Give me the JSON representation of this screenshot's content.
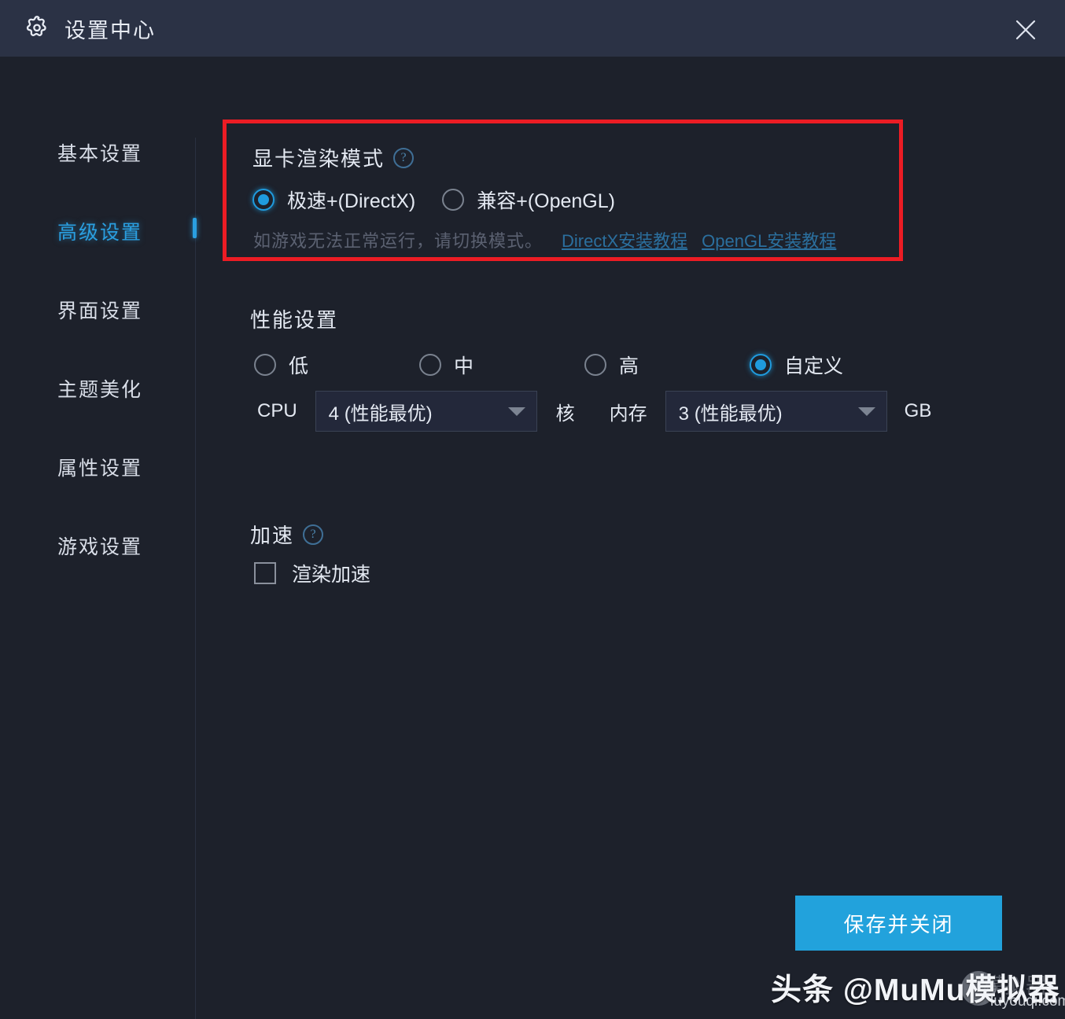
{
  "window": {
    "title": "设置中心",
    "gear_icon": "gear-icon",
    "close_icon": "close-icon"
  },
  "sidebar": {
    "items": [
      {
        "label": "基本设置",
        "active": false
      },
      {
        "label": "高级设置",
        "active": true
      },
      {
        "label": "界面设置",
        "active": false
      },
      {
        "label": "主题美化",
        "active": false
      },
      {
        "label": "属性设置",
        "active": false
      },
      {
        "label": "游戏设置",
        "active": false
      }
    ]
  },
  "render_mode": {
    "title": "显卡渲染模式",
    "help_icon": "?",
    "options": [
      {
        "label": "极速+(DirectX)",
        "selected": true
      },
      {
        "label": "兼容+(OpenGL)",
        "selected": false
      }
    ],
    "hint": "如游戏无法正常运行，请切换模式。",
    "links": [
      "DirectX安装教程",
      "OpenGL安装教程"
    ]
  },
  "performance": {
    "title": "性能设置",
    "options": [
      {
        "label": "低",
        "selected": false
      },
      {
        "label": "中",
        "selected": false
      },
      {
        "label": "高",
        "selected": false
      },
      {
        "label": "自定义",
        "selected": true
      }
    ],
    "cpu": {
      "label": "CPU",
      "value": "4 (性能最优)",
      "unit": "核"
    },
    "memory": {
      "label": "内存",
      "value": "3 (性能最优)",
      "unit": "GB"
    }
  },
  "acceleration": {
    "title": "加速",
    "help_icon": "?",
    "checkbox": {
      "label": "渲染加速",
      "checked": false
    }
  },
  "footer": {
    "save_label": "保存并关闭"
  },
  "watermark": {
    "main": "头条 @MuMu模拟器",
    "ghost": "模拟器",
    "site": "luyouqi.com"
  },
  "colors": {
    "titlebar": "#2b3245",
    "background": "#1d212b",
    "accent": "#22a2dc",
    "highlight_border": "#ec1c24",
    "link": "#2b6f9e"
  }
}
